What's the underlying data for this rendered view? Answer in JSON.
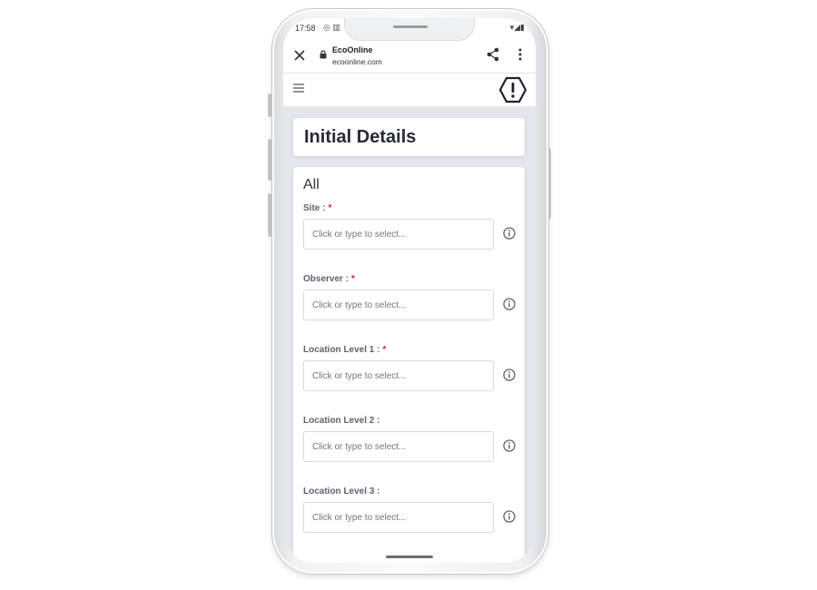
{
  "status_bar": {
    "time": "17:58",
    "left_icons": "◎ ▥",
    "right_icons": "▾◢▮"
  },
  "browser": {
    "site_title": "EcoOnline",
    "site_url": "ecoonline.com",
    "close_icon": "close-icon",
    "share_icon": "share-icon",
    "more_icon": "more-vertical-icon"
  },
  "page": {
    "title": "Initial Details",
    "section_title": "All",
    "fields": [
      {
        "label": "Site :",
        "required": "*",
        "placeholder": "Click or type to select..."
      },
      {
        "label": "Observer :",
        "required": "*",
        "placeholder": "Click or type to select..."
      },
      {
        "label": "Location Level 1 :",
        "required": "*",
        "placeholder": "Click or type to select..."
      },
      {
        "label": "Location Level 2 :",
        "required": "",
        "placeholder": "Click or type to select..."
      },
      {
        "label": "Location Level 3 :",
        "required": "",
        "placeholder": "Click or type to select..."
      }
    ]
  },
  "colors": {
    "required": "#d0202f",
    "background": "#e3e7ed",
    "title_text": "#262b36"
  }
}
